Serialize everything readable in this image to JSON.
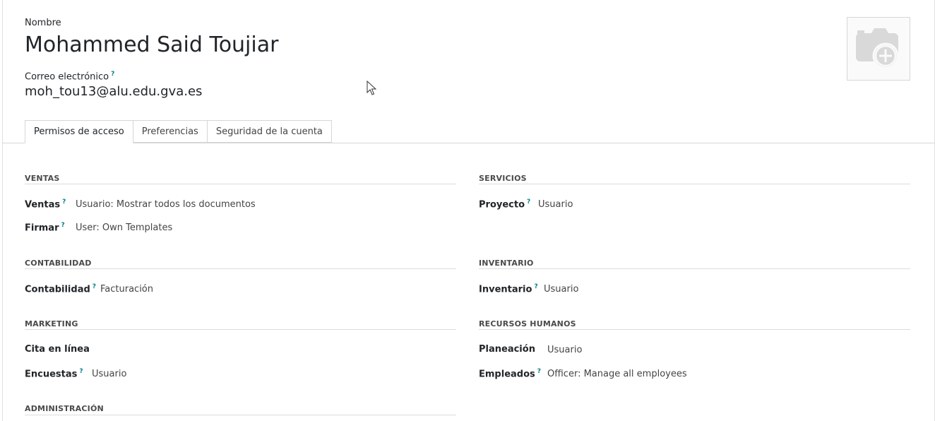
{
  "header": {
    "name_label": "Nombre",
    "name_value": "Mohammed Said Toujiar",
    "email_label": "Correo electrónico",
    "email_value": "moh_tou13@alu.edu.gva.es",
    "help_mark": "?"
  },
  "tabs": [
    {
      "label": "Permisos de acceso",
      "active": true
    },
    {
      "label": "Preferencias",
      "active": false
    },
    {
      "label": "Seguridad de la cuenta",
      "active": false
    }
  ],
  "groups": {
    "ventas": {
      "title": "VENTAS",
      "fields": [
        {
          "label": "Ventas",
          "value": "Usuario: Mostrar todos los documentos",
          "help": true
        },
        {
          "label": "Firmar",
          "value": "User: Own Templates",
          "help": true
        }
      ]
    },
    "servicios": {
      "title": "SERVICIOS",
      "fields": [
        {
          "label": "Proyecto",
          "value": "Usuario",
          "help": true
        }
      ]
    },
    "contabilidad": {
      "title": "CONTABILIDAD",
      "fields": [
        {
          "label": "Contabilidad",
          "value": "Facturación",
          "help": true
        }
      ]
    },
    "inventario": {
      "title": "INVENTARIO",
      "fields": [
        {
          "label": "Inventario",
          "value": "Usuario",
          "help": true
        }
      ]
    },
    "marketing": {
      "title": "MARKETING",
      "fields": [
        {
          "label": "Cita en línea",
          "value": "",
          "help": false
        },
        {
          "label": "Encuestas",
          "value": "Usuario",
          "help": true
        }
      ]
    },
    "rrhh": {
      "title": "RECURSOS HUMANOS",
      "fields": [
        {
          "label": "Planeación",
          "value": "Usuario",
          "help": false
        },
        {
          "label": "Empleados",
          "value": "Officer: Manage all employees",
          "help": true
        }
      ]
    },
    "administracion": {
      "title": "ADMINISTRACIÓN"
    }
  },
  "icons": {
    "avatar": "camera-add-icon",
    "cursor": "mouse-pointer-icon"
  },
  "colors": {
    "help_mark": "#017e84",
    "avatar_icon": "#d9d9d9"
  }
}
